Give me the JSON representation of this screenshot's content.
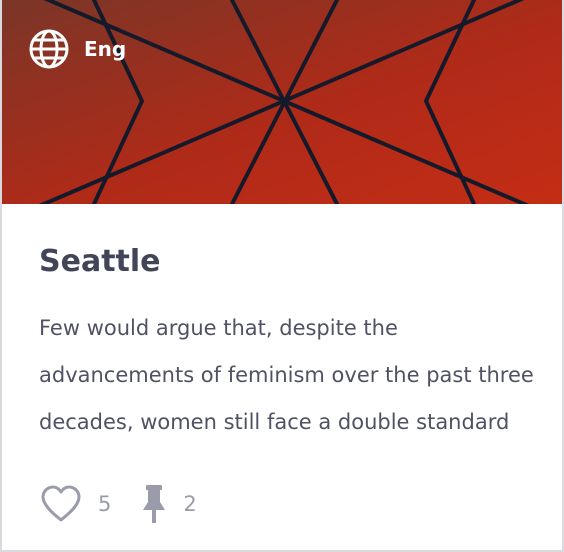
{
  "card": {
    "language": "Eng",
    "title": "Seattle",
    "excerpt": "Few would argue that, despite the advancements of feminism over the past three decades, women still face a double standard when it comes to their behavior.",
    "likes": "5",
    "pins": "2"
  },
  "icons": {
    "language": "globe-icon",
    "likes": "heart-icon",
    "pins": "pushpin-icon"
  },
  "colors": {
    "banner_start": "#7f3326",
    "banner_end": "#c12c17",
    "pattern_line": "#141a2a",
    "title": "#424558",
    "body_text": "#505264",
    "muted": "#9a9cab",
    "border": "#d9d9de"
  }
}
